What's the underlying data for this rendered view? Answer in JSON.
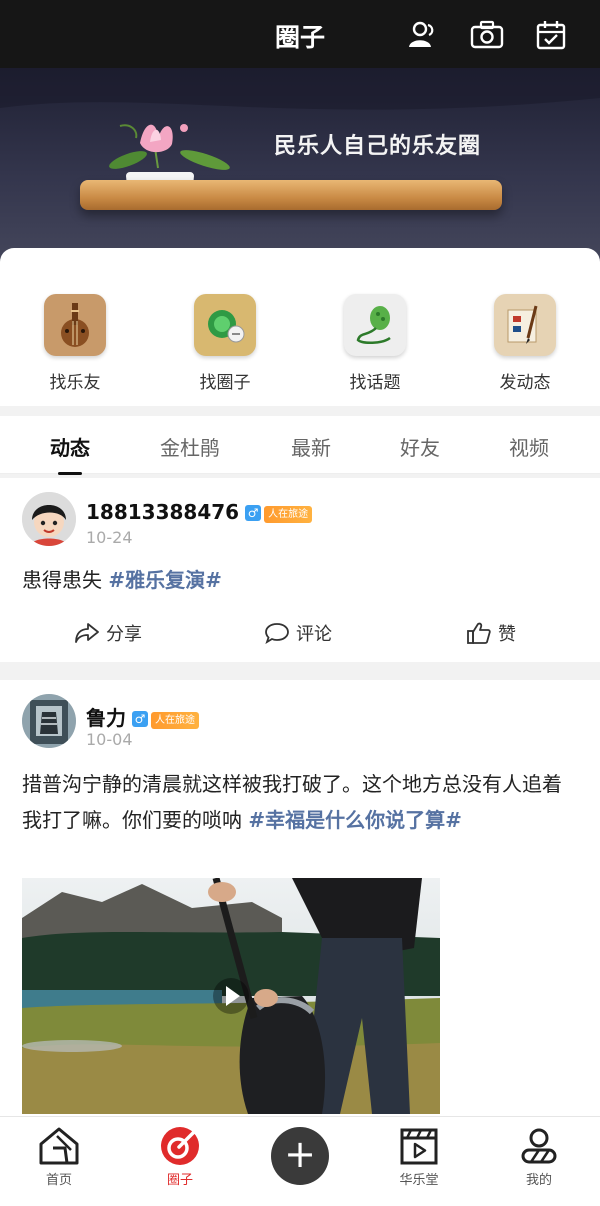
{
  "topbar": {
    "title": "圈子",
    "icons": [
      "contacts-icon",
      "camera-icon",
      "calendar-check-icon"
    ]
  },
  "banner": {
    "slogan": "民乐人自己的乐友圈"
  },
  "quick": {
    "items": [
      {
        "label": "找乐友",
        "icon": "pipa-icon"
      },
      {
        "label": "找圈子",
        "icon": "circle-icon"
      },
      {
        "label": "找话题",
        "icon": "lotus-topic-icon"
      },
      {
        "label": "发动态",
        "icon": "post-icon"
      }
    ]
  },
  "tabs": [
    "动态",
    "金杜鹃",
    "最新",
    "好友",
    "视频"
  ],
  "posts": [
    {
      "user": "18813388476",
      "gender": "♂",
      "badge": "人在旅途",
      "date": "10-24",
      "text": "患得患失 ",
      "topic": "#雅乐复演#",
      "actions": {
        "share": "分享",
        "comment": "评论",
        "like": "赞"
      }
    },
    {
      "user": "鲁力",
      "gender": "♂",
      "badge": "人在旅途",
      "date": "10-04",
      "text": "措普沟宁静的清晨就这样被我打破了。这个地方总没有人追着我打了嘛。你们要的唢呐 ",
      "topic": "#幸福是什么你说了算#"
    }
  ],
  "bottomnav": {
    "items": [
      {
        "label": "首页",
        "icon": "home-icon"
      },
      {
        "label": "圈子",
        "icon": "circle-nav-icon"
      },
      {
        "label": "",
        "icon": "plus-icon"
      },
      {
        "label": "华乐堂",
        "icon": "clapperboard-icon"
      },
      {
        "label": "我的",
        "icon": "profile-icon"
      }
    ]
  },
  "colors": {
    "topic": "#5672a2",
    "active_nav": "#e02b2b",
    "badge": "#ff9a2e",
    "gender": "#3ba0f2"
  }
}
